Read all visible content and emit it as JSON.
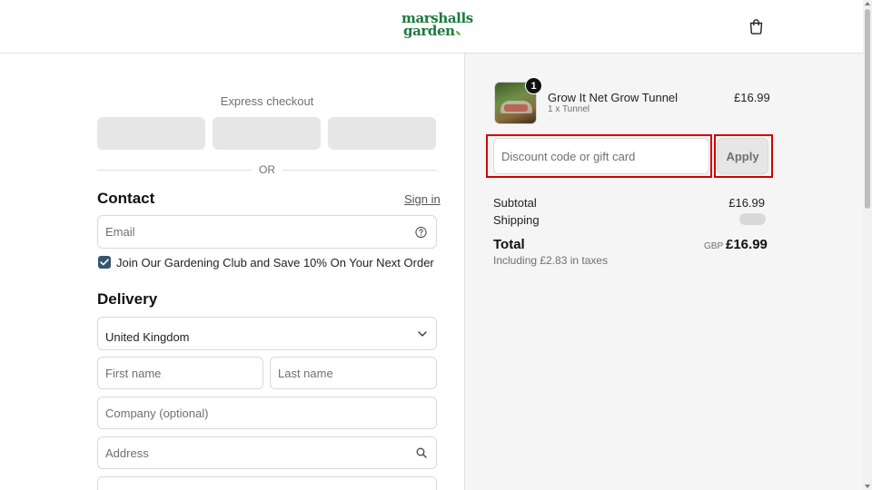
{
  "brand": {
    "logo_line1": "marshalls",
    "logo_line2": "garden",
    "accent": "#1c7a3e",
    "leaf_color": "#6cb33f"
  },
  "header": {
    "bag_icon": "shopping-bag-icon"
  },
  "express": {
    "title": "Express checkout",
    "buttons": [
      "",
      "",
      ""
    ],
    "divider_text": "OR"
  },
  "contact": {
    "title": "Contact",
    "sign_in": "Sign in",
    "email_placeholder": "Email",
    "help_icon": "help-circle-icon",
    "newsletter_label": "Join Our Gardening Club and Save 10% On Your Next Order",
    "newsletter_checked": true
  },
  "delivery": {
    "title": "Delivery",
    "country": "United Kingdom",
    "first_name_placeholder": "First name",
    "last_name_placeholder": "Last name",
    "company_placeholder": "Company (optional)",
    "address_placeholder": "Address"
  },
  "order": {
    "item": {
      "name": "Grow It Net Grow Tunnel",
      "variant": "1 x Tunnel",
      "price": "£16.99",
      "quantity": "1"
    },
    "discount_placeholder": "Discount code or gift card",
    "apply_label": "Apply",
    "subtotal_label": "Subtotal",
    "subtotal_value": "£16.99",
    "shipping_label": "Shipping",
    "total_label": "Total",
    "currency": "GBP",
    "total_value": "£16.99",
    "tax_note": "Including £2.83 in taxes"
  },
  "colors": {
    "highlight": "#d40000",
    "checkbox": "#35566e"
  }
}
